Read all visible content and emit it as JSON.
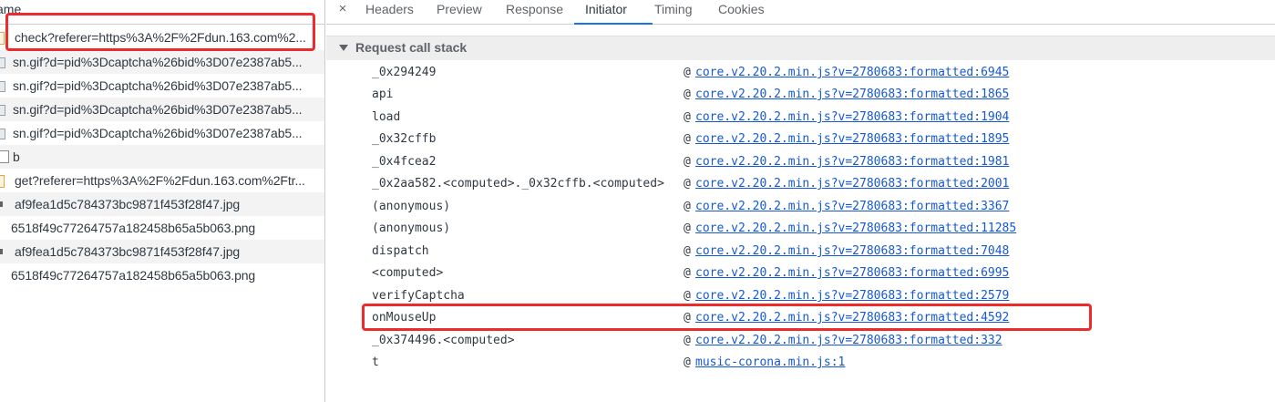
{
  "left": {
    "header": "ame",
    "requests": [
      {
        "name": "check?referer=https%3A%2F%2Fdun.163.com%2...",
        "type": "xhr",
        "selected": true
      },
      {
        "name": "sn.gif?d=pid%3Dcaptcha%26bid%3D07e2387ab5...",
        "type": "img"
      },
      {
        "name": "sn.gif?d=pid%3Dcaptcha%26bid%3D07e2387ab5...",
        "type": "img"
      },
      {
        "name": "sn.gif?d=pid%3Dcaptcha%26bid%3D07e2387ab5...",
        "type": "img"
      },
      {
        "name": "sn.gif?d=pid%3Dcaptcha%26bid%3D07e2387ab5...",
        "type": "img"
      },
      {
        "name": "b",
        "type": "doc"
      },
      {
        "name": "get?referer=https%3A%2F%2Fdun.163.com%2Ftr...",
        "type": "xhr"
      },
      {
        "name": "af9fea1d5c784373bc9871f453f28f47.jpg",
        "type": "small"
      },
      {
        "name": "6518f49c77264757a182458b65a5b063.png",
        "type": "none"
      },
      {
        "name": "af9fea1d5c784373bc9871f453f28f47.jpg",
        "type": "small"
      },
      {
        "name": "6518f49c77264757a182458b65a5b063.png",
        "type": "none"
      }
    ]
  },
  "tabs": {
    "close": "×",
    "items": [
      "Headers",
      "Preview",
      "Response",
      "Initiator",
      "Timing",
      "Cookies"
    ],
    "active": "Initiator"
  },
  "section": {
    "title": "Request call stack"
  },
  "stack": [
    {
      "fn": "_0x294249",
      "at": "@",
      "src": "core.v2.20.2.min.js?v=2780683:formatted:6945"
    },
    {
      "fn": "api",
      "at": "@",
      "src": "core.v2.20.2.min.js?v=2780683:formatted:1865"
    },
    {
      "fn": "load",
      "at": "@",
      "src": "core.v2.20.2.min.js?v=2780683:formatted:1904"
    },
    {
      "fn": "_0x32cffb",
      "at": "@",
      "src": "core.v2.20.2.min.js?v=2780683:formatted:1895"
    },
    {
      "fn": "_0x4fcea2",
      "at": "@",
      "src": "core.v2.20.2.min.js?v=2780683:formatted:1981"
    },
    {
      "fn": "_0x2aa582.<computed>._0x32cffb.<computed>",
      "at": "@",
      "src": "core.v2.20.2.min.js?v=2780683:formatted:2001"
    },
    {
      "fn": "(anonymous)",
      "at": "@",
      "src": "core.v2.20.2.min.js?v=2780683:formatted:3367"
    },
    {
      "fn": "(anonymous)",
      "at": "@",
      "src": "core.v2.20.2.min.js?v=2780683:formatted:11285"
    },
    {
      "fn": "dispatch",
      "at": "@",
      "src": "core.v2.20.2.min.js?v=2780683:formatted:7048"
    },
    {
      "fn": "<computed>",
      "at": "@",
      "src": "core.v2.20.2.min.js?v=2780683:formatted:6995"
    },
    {
      "fn": "verifyCaptcha",
      "at": "@",
      "src": "core.v2.20.2.min.js?v=2780683:formatted:2579"
    },
    {
      "fn": "onMouseUp",
      "at": "@",
      "src": "core.v2.20.2.min.js?v=2780683:formatted:4592"
    },
    {
      "fn": "_0x374496.<computed>",
      "at": "@",
      "src": "core.v2.20.2.min.js?v=2780683:formatted:332"
    },
    {
      "fn": "t",
      "at": "@",
      "src": "music-corona.min.js:1"
    }
  ],
  "colors": {
    "highlight": "#ee2b2b",
    "link": "#1558d6",
    "active_tab": "#1a73e8"
  }
}
